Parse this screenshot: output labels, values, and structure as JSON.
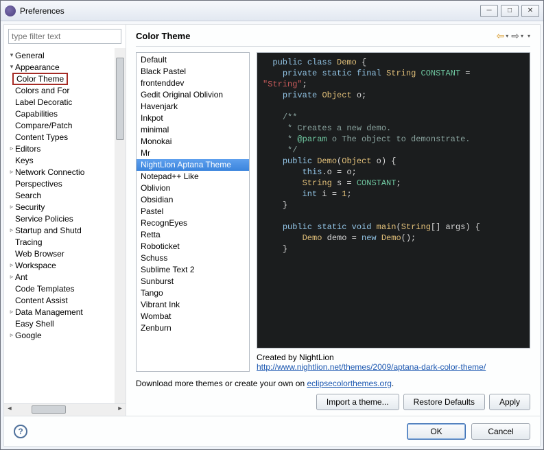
{
  "window": {
    "title": "Preferences"
  },
  "filter": {
    "placeholder": "type filter text"
  },
  "tree": [
    {
      "label": "General",
      "depth": 1,
      "tw": "▾"
    },
    {
      "label": "Appearance",
      "depth": 2,
      "tw": "▾"
    },
    {
      "label": "Color Theme",
      "depth": 3,
      "highlight": true
    },
    {
      "label": "Colors and For",
      "depth": 3
    },
    {
      "label": "Label Decoratic",
      "depth": 3
    },
    {
      "label": "Capabilities",
      "depth": 2
    },
    {
      "label": "Compare/Patch",
      "depth": 2
    },
    {
      "label": "Content Types",
      "depth": 2
    },
    {
      "label": "Editors",
      "depth": 2,
      "tw": "▹"
    },
    {
      "label": "Keys",
      "depth": 2
    },
    {
      "label": "Network Connectio",
      "depth": 2,
      "tw": "▹"
    },
    {
      "label": "Perspectives",
      "depth": 2
    },
    {
      "label": "Search",
      "depth": 2
    },
    {
      "label": "Security",
      "depth": 2,
      "tw": "▹"
    },
    {
      "label": "Service Policies",
      "depth": 2
    },
    {
      "label": "Startup and Shutd",
      "depth": 2,
      "tw": "▹"
    },
    {
      "label": "Tracing",
      "depth": 2
    },
    {
      "label": "Web Browser",
      "depth": 2
    },
    {
      "label": "Workspace",
      "depth": 2,
      "tw": "▹"
    },
    {
      "label": "Ant",
      "depth": 1,
      "tw": "▹"
    },
    {
      "label": "Code Templates",
      "depth": 1
    },
    {
      "label": "Content Assist",
      "depth": 1
    },
    {
      "label": "Data Management",
      "depth": 1,
      "tw": "▹"
    },
    {
      "label": "Easy Shell",
      "depth": 1
    },
    {
      "label": "Google",
      "depth": 1,
      "tw": "▹"
    }
  ],
  "page": {
    "title": "Color Theme",
    "themes": [
      "Default",
      "Black Pastel",
      "frontenddev",
      "Gedit Original Oblivion",
      "Havenjark",
      "Inkpot",
      "minimal",
      "Monokai",
      "Mr",
      "NightLion Aptana Theme",
      "Notepad++ Like",
      "Oblivion",
      "Obsidian",
      "Pastel",
      "RecognEyes",
      "Retta",
      "Roboticket",
      "Schuss",
      "Sublime Text 2",
      "Sunburst",
      "Tango",
      "Vibrant Ink",
      "Wombat",
      "Zenburn"
    ],
    "selected_index": 9,
    "created_by": "Created by NightLion",
    "theme_url": "http://www.nightlion.net/themes/2009/aptana-dark-color-theme/",
    "download_prefix": "Download more themes or create your own on ",
    "download_link": "eclipsecolorthemes.org",
    "download_suffix": ".",
    "import_btn": "Import a theme...",
    "restore_btn": "Restore Defaults",
    "apply_btn": "Apply"
  },
  "code": {
    "l1a": "public",
    "l1b": "class",
    "l1c": "Demo",
    "l1d": " {",
    "l2a": "private",
    "l2b": "static",
    "l2c": "final",
    "l2d": "String",
    "l2e": "CONSTANT",
    "l2f": " =",
    "l3a": "\"String\"",
    "l3b": ";",
    "l4a": "private",
    "l4b": "Object",
    "l4c": " o;",
    "l5a": "/**",
    "l6a": " * Creates a new demo.",
    "l7a": " * ",
    "l7b": "@param",
    "l7c": " o The object to demonstrate.",
    "l8a": " */",
    "l9a": "public",
    "l9b": "Demo",
    "l9c": "(",
    "l9d": "Object",
    "l9e": " o) {",
    "l10a": "this",
    "l10b": ".o = o;",
    "l11a": "String",
    "l11b": " s = ",
    "l11c": "CONSTANT",
    "l11d": ";",
    "l12a": "int",
    "l12b": " i = ",
    "l12c": "1",
    "l12d": ";",
    "l13a": "}",
    "l14a": "public",
    "l14b": "static",
    "l14c": "void",
    "l14d": "main",
    "l14e": "(",
    "l14f": "String",
    "l14g": "[] args) {",
    "l15a": "Demo",
    "l15b": " demo = ",
    "l15c": "new",
    "l15d": "Demo",
    "l15e": "();",
    "l16a": "}"
  },
  "footer": {
    "ok": "OK",
    "cancel": "Cancel"
  }
}
